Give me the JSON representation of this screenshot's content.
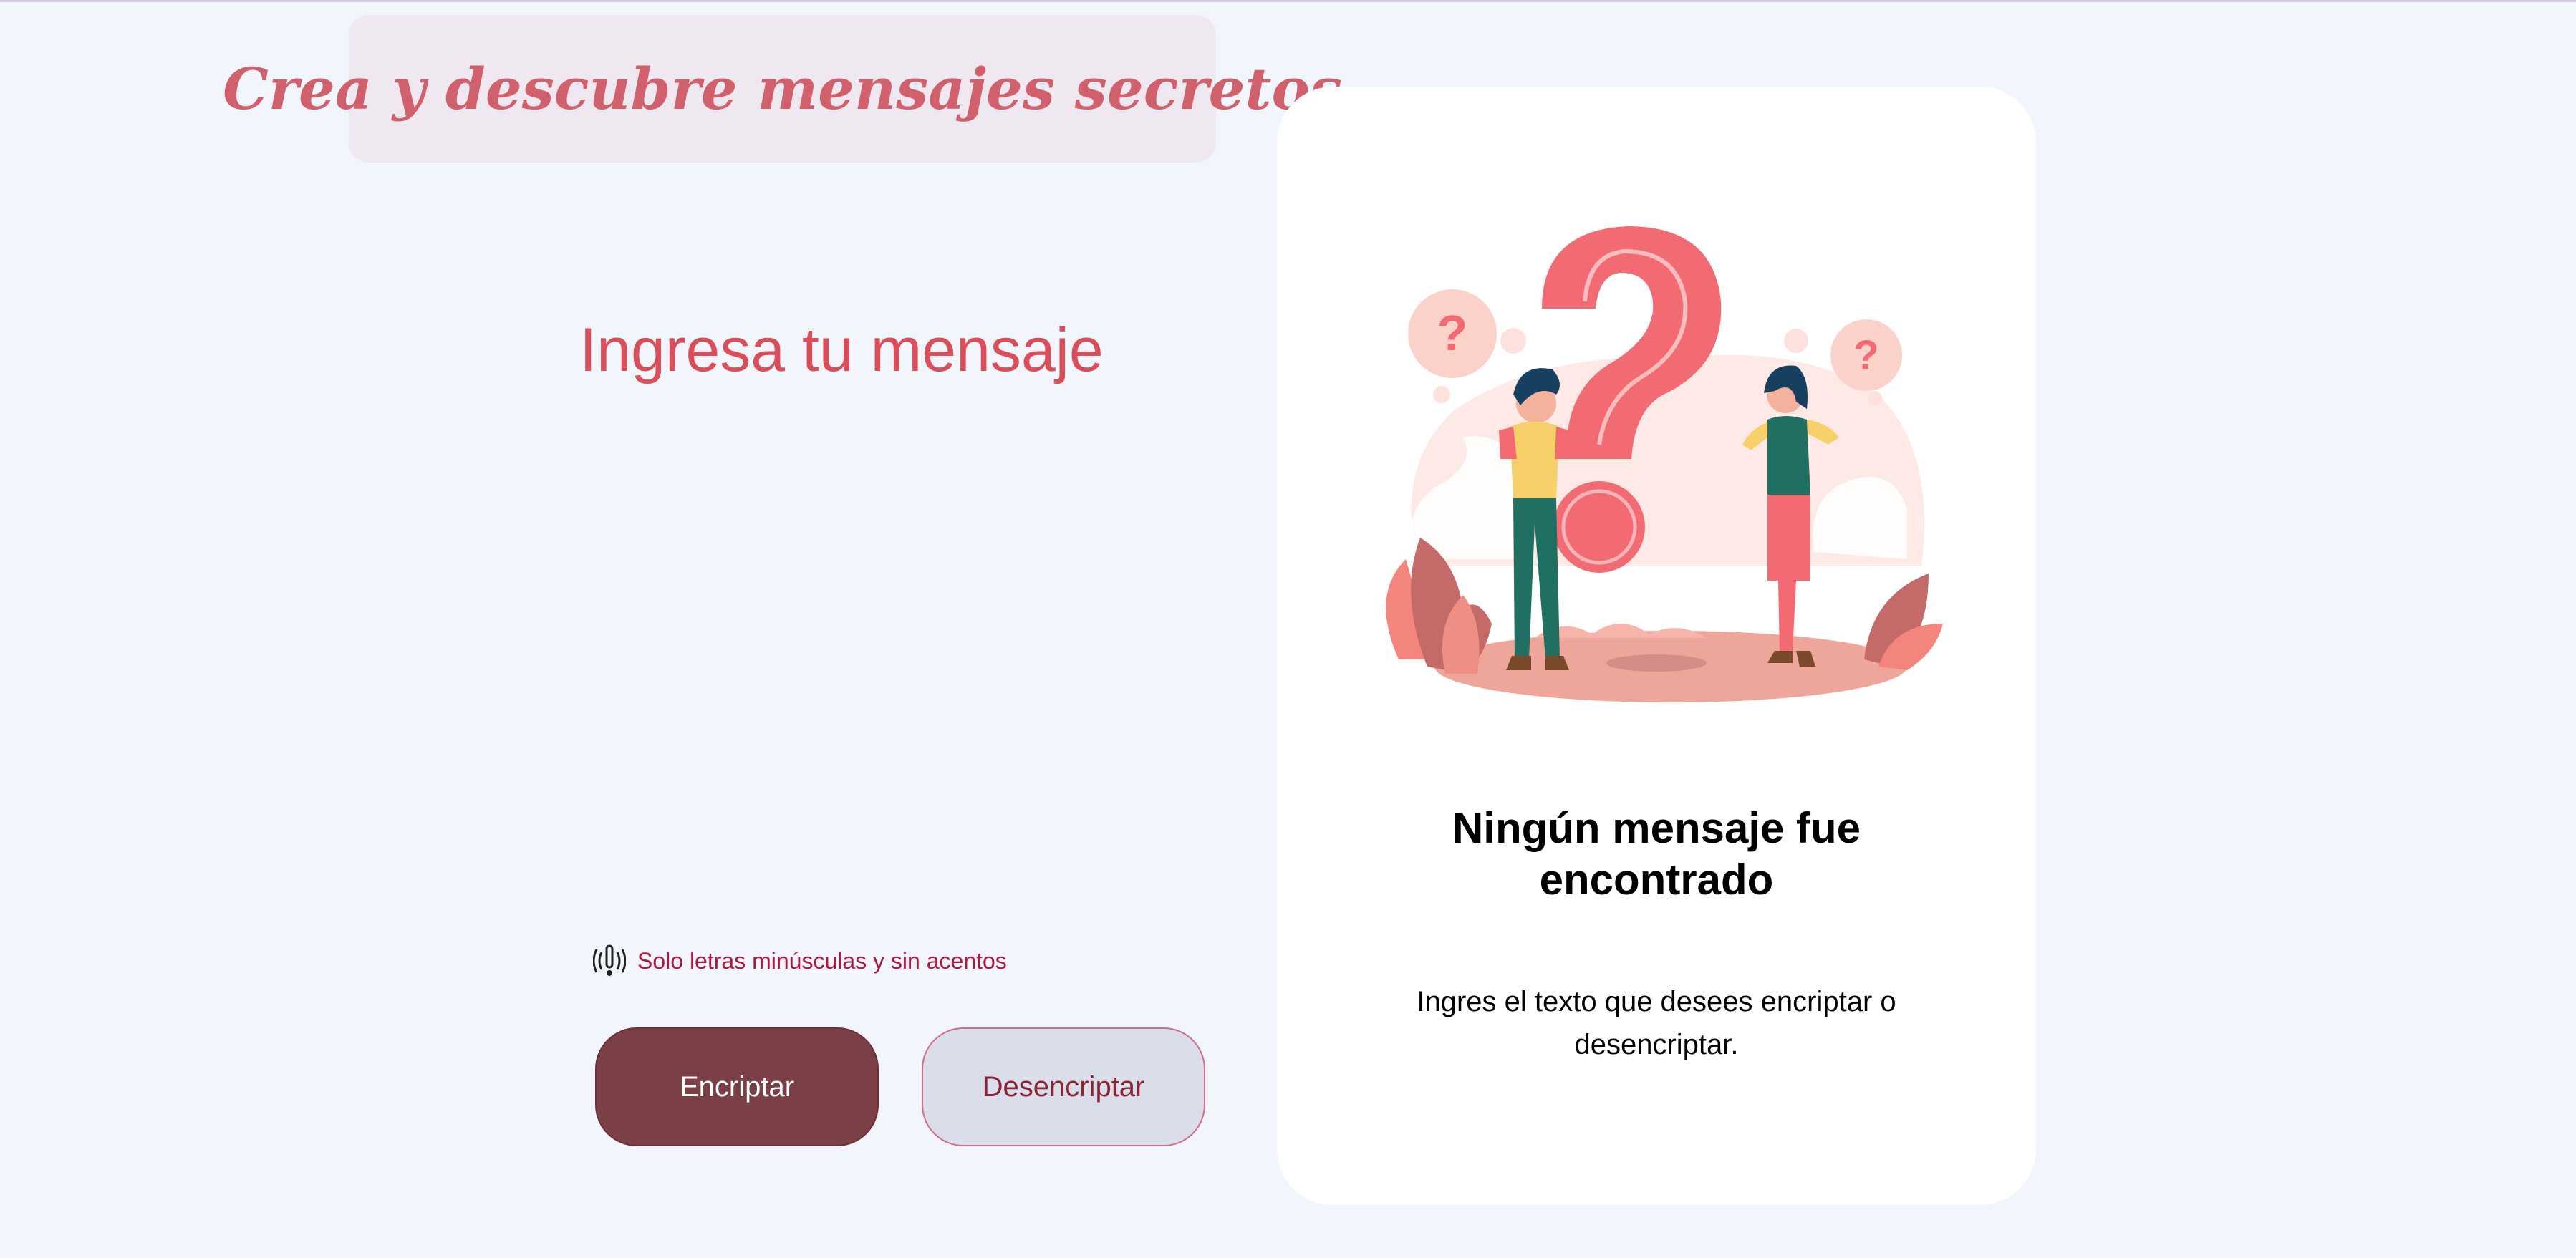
{
  "header": {
    "title": "Crea y descubre mensajes secretos"
  },
  "input": {
    "prompt": "Ingresa tu mensaje",
    "placeholder": "",
    "value": ""
  },
  "hint": {
    "icon": "alert-icon",
    "text": "Solo letras minúsculas y sin acentos"
  },
  "buttons": {
    "encrypt_label": "Encriptar",
    "decrypt_label": "Desencriptar"
  },
  "output": {
    "illustration": "question-people-illustration",
    "title": "Ningún mensaje fue encontrado",
    "description": "Ingres el texto que desees encriptar o desencriptar."
  },
  "colors": {
    "background": "#f3f5fc",
    "accent": "#d94e59",
    "banner_bg": "#f0e8f0",
    "encrypt_button": "#7b3f46",
    "decrypt_button": "#dadeea",
    "hint_text": "#b3163c"
  }
}
